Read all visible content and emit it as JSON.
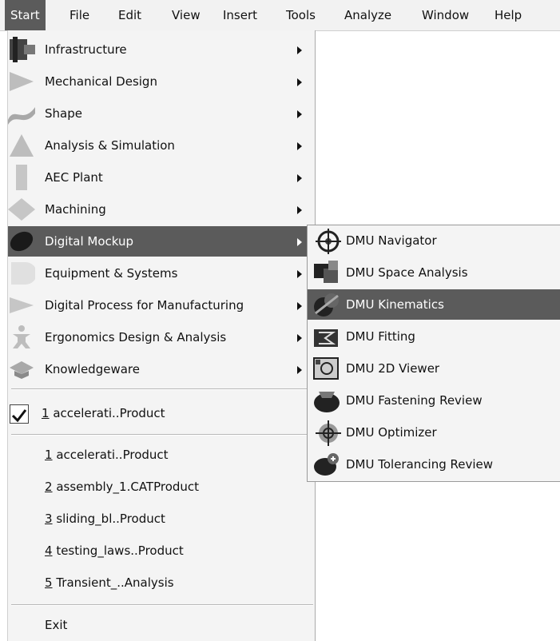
{
  "menubar": {
    "items": [
      "Start",
      "File",
      "Edit",
      "View",
      "Insert",
      "Tools",
      "Analyze",
      "Window",
      "Help"
    ],
    "underline_letters": [
      "S",
      "F",
      "E",
      "V",
      "I",
      "T",
      "A",
      "W",
      "H"
    ]
  },
  "start_menu": {
    "workbenches": [
      {
        "label": "Infrastructure",
        "underline": "I",
        "icon": "infrastructure-icon"
      },
      {
        "label": "Mechanical Design",
        "underline": "M",
        "icon": "mechanical-design-icon"
      },
      {
        "label": "Shape",
        "underline": "S",
        "icon": "shape-icon"
      },
      {
        "label": "Analysis & Simulation",
        "underline": "A",
        "icon": "analysis-simulation-icon"
      },
      {
        "label": "AEC Plant",
        "underline": "C",
        "icon": "aec-plant-icon"
      },
      {
        "label": "Machining",
        "underline": "h",
        "icon": "machining-icon"
      },
      {
        "label": "Digital Mockup",
        "underline": "D",
        "icon": "digital-mockup-icon"
      },
      {
        "label": "Equipment & Systems",
        "underline": "q",
        "icon": "equipment-systems-icon"
      },
      {
        "label": "Digital Process for Manufacturing",
        "underline": "g",
        "icon": "digital-process-icon"
      },
      {
        "label": "Ergonomics Design & Analysis",
        "underline": "r",
        "icon": "ergonomics-icon"
      },
      {
        "label": "Knowledgeware",
        "underline": "K",
        "icon": "knowledgeware-icon"
      }
    ],
    "active_workbench": "Digital Mockup",
    "checked_document": {
      "num": "1",
      "rest": " accelerati..Product"
    },
    "recent_files": [
      {
        "num": "1",
        "rest": " accelerati..Product"
      },
      {
        "num": "2",
        "rest": " assembly_1.CATProduct"
      },
      {
        "num": "3",
        "rest": " sliding_bl..Product"
      },
      {
        "num": "4",
        "rest": " testing_laws..Product"
      },
      {
        "num": "5",
        "rest": " Transient_..Analysis"
      }
    ],
    "exit_label": "Exit"
  },
  "submenu": {
    "items": [
      {
        "label": "DMU Navigator",
        "icon": "dmu-navigator-icon"
      },
      {
        "label": "DMU Space Analysis",
        "icon": "dmu-space-analysis-icon"
      },
      {
        "label": "DMU Kinematics",
        "icon": "dmu-kinematics-icon"
      },
      {
        "label": "DMU Fitting",
        "icon": "dmu-fitting-icon"
      },
      {
        "label": "DMU 2D Viewer",
        "icon": "dmu-2d-viewer-icon"
      },
      {
        "label": "DMU Fastening Review",
        "icon": "dmu-fastening-review-icon"
      },
      {
        "label": "DMU Optimizer",
        "icon": "dmu-optimizer-icon"
      },
      {
        "label": "DMU Tolerancing Review",
        "icon": "dmu-tolerancing-review-icon"
      }
    ],
    "active_item": "DMU Kinematics"
  }
}
